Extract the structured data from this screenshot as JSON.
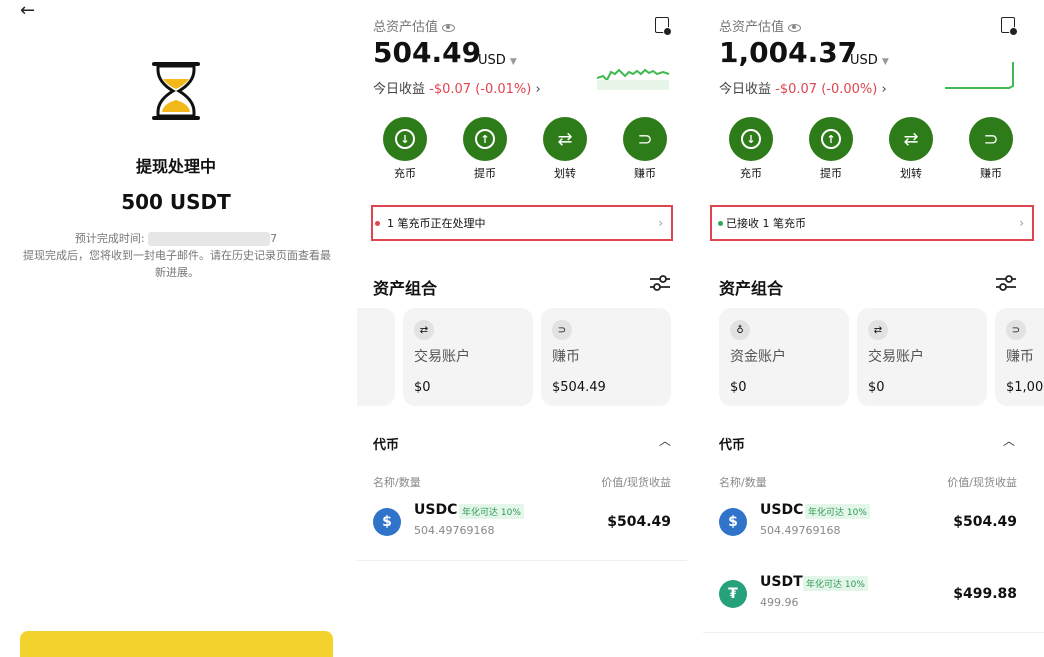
{
  "screen1": {
    "back_icon": "arrow-left-icon",
    "title": "提现处理中",
    "amount": "500 USDT",
    "eta_label": "预计完成时间:",
    "eta_tail": "7",
    "note": "提现完成后，您将收到一封电子邮件。请在历史记录页面查看最新进展。",
    "button_label": ""
  },
  "screen2": {
    "est_label": "总资产估值",
    "total": "504.49",
    "currency": "USD",
    "pnl_label": "今日收益",
    "pnl_value": "-$0.07 (-0.01%)",
    "actions": [
      "充币",
      "提币",
      "划转",
      "赚币"
    ],
    "notice": "1 笔充币正在处理中",
    "portfolio_title": "资产组合",
    "cards": [
      {
        "name": "交易账户",
        "value": "$0",
        "icon": "⇄"
      },
      {
        "name": "赚币",
        "value": "$504.49",
        "icon": "⊃"
      }
    ],
    "token_title": "代币",
    "col_left": "名称/数量",
    "col_right": "价值/现货收益",
    "tokens": [
      {
        "symbol": "USDC",
        "apy": "年化可达 10%",
        "qty": "504.49769168",
        "value": "$504.49"
      }
    ]
  },
  "screen3": {
    "est_label": "总资产估值",
    "total": "1,004.37",
    "currency": "USD",
    "pnl_label": "今日收益",
    "pnl_value": "-$0.07 (-0.00%)",
    "actions": [
      "充币",
      "提币",
      "划转",
      "赚币"
    ],
    "notice": "已接收 1 笔充币",
    "portfolio_title": "资产组合",
    "cards": [
      {
        "name": "资金账户",
        "value": "$0",
        "icon": "♁"
      },
      {
        "name": "交易账户",
        "value": "$0",
        "icon": "⇄"
      },
      {
        "name": "赚币",
        "value": "$1,00",
        "icon": "⊃"
      }
    ],
    "token_title": "代币",
    "col_left": "名称/数量",
    "col_right": "价值/现货收益",
    "tokens": [
      {
        "symbol": "USDC",
        "apy": "年化可达 10%",
        "qty": "504.49769168",
        "value": "$504.49"
      },
      {
        "symbol": "USDT",
        "apy": "年化可达 10%",
        "qty": "499.96",
        "value": "$499.88"
      }
    ]
  },
  "colors": {
    "brand_green": "#2e7b1a",
    "loss_red": "#e0454f",
    "accent_yellow": "#f3d22e",
    "highlight_red": "#e0454f"
  }
}
